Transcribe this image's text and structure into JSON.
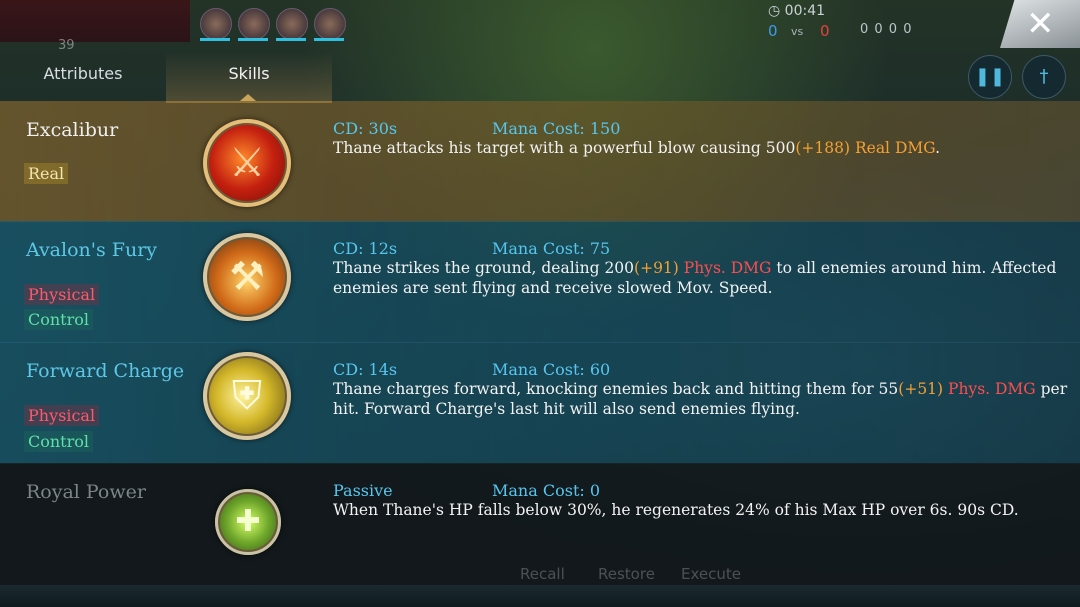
{
  "hud": {
    "timer": "00:41",
    "score_blue": "0",
    "score_vs": "vs",
    "score_red": "0",
    "kda": "0  0  0  0",
    "left_number": "39",
    "close_label": "✕",
    "pause_icon": "pause-icon",
    "weapon_icon": "sword-icon"
  },
  "tabs": [
    {
      "label": "Attributes",
      "active": false
    },
    {
      "label": "Skills",
      "active": true
    }
  ],
  "skills": [
    {
      "name": "Excalibur",
      "tags": [
        "Real"
      ],
      "cd": "CD: 30s",
      "mana": "Mana Cost: 150",
      "desc_pre": "Thane attacks his target with a powerful blow causing 500",
      "desc_bonus": "(+188)",
      "desc_dmg": " Real DMG",
      "desc_post": ".",
      "icon": "sword-icon"
    },
    {
      "name": "Avalon's Fury",
      "tags": [
        "Physical",
        "Control"
      ],
      "cd": "CD: 12s",
      "mana": "Mana Cost: 75",
      "desc_pre": "Thane strikes the ground, dealing 200",
      "desc_bonus": "(+91)",
      "desc_dmg": " Phys. DMG",
      "desc_post": " to all enemies around him. Affected enemies are sent flying and receive slowed Mov. Speed.",
      "icon": "ground-strike-icon"
    },
    {
      "name": "Forward Charge",
      "tags": [
        "Physical",
        "Control"
      ],
      "cd": "CD: 14s",
      "mana": "Mana Cost: 60",
      "desc_pre": "Thane charges forward, knocking enemies back and hitting them for 55",
      "desc_bonus": "(+51)",
      "desc_dmg": " Phys. DMG",
      "desc_post": " per hit. Forward Charge's last hit will also send enemies flying.",
      "icon": "charge-icon"
    },
    {
      "name": "Royal Power",
      "tags": [],
      "cd": "Passive",
      "mana": "Mana Cost: 0",
      "desc_full": "When Thane's HP falls below 30%, he regenerates 24% of his Max HP over 6s. 90s CD.",
      "icon": "heal-icon"
    }
  ],
  "bottom": {
    "recall": "Recall",
    "restore": "Restore",
    "execute": "Execute"
  }
}
